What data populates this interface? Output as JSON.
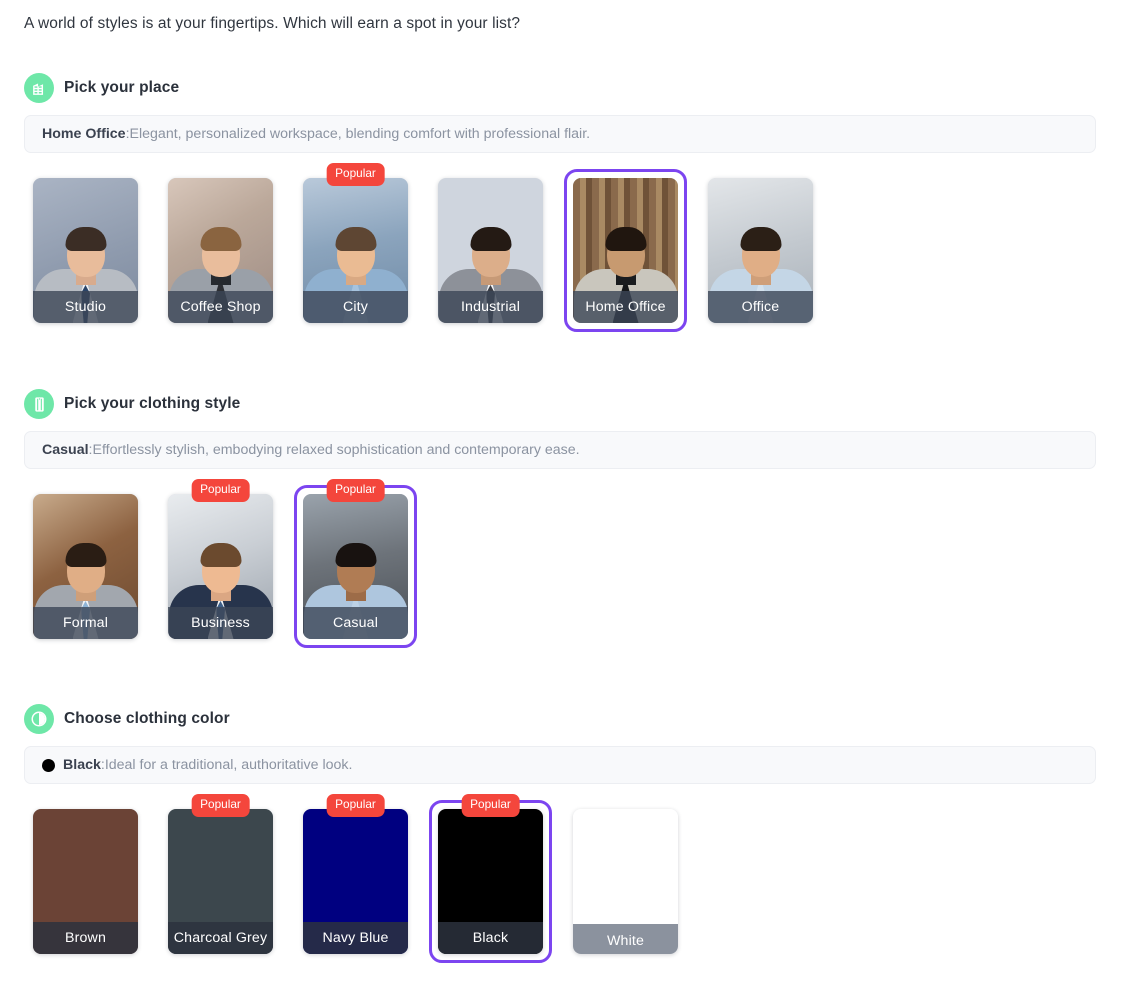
{
  "intro": "A world of styles is at your fingertips. Which will earn a spot in your list?",
  "colors": {
    "accent_purple": "#7c45f0",
    "badge_red": "#f4463c",
    "icon_green": "#6ee7a8",
    "label_bar": "#3c4656"
  },
  "sections": [
    {
      "id": "place",
      "icon": "building-icon",
      "title": "Pick your place",
      "description": {
        "name": "Home Office",
        "separator": ":",
        "text": " Elegant, personalized workspace, blending comfort with professional flair."
      },
      "cards": [
        {
          "label": "Studio",
          "popular": false,
          "selected": false
        },
        {
          "label": "Coffee Shop",
          "popular": false,
          "selected": false
        },
        {
          "label": "City",
          "popular": true,
          "selected": false
        },
        {
          "label": "Industrial",
          "popular": false,
          "selected": false
        },
        {
          "label": "Home Office",
          "popular": false,
          "selected": true
        },
        {
          "label": "Office",
          "popular": false,
          "selected": false
        }
      ]
    },
    {
      "id": "style",
      "icon": "shirt-icon",
      "title": "Pick your clothing style",
      "description": {
        "name": "Casual",
        "separator": ":",
        "text": " Effortlessly stylish, embodying relaxed sophistication and contemporary ease."
      },
      "cards": [
        {
          "label": "Formal",
          "popular": false,
          "selected": false
        },
        {
          "label": "Business",
          "popular": true,
          "selected": false
        },
        {
          "label": "Casual",
          "popular": true,
          "selected": true
        }
      ]
    },
    {
      "id": "color",
      "icon": "contrast-icon",
      "title": "Choose clothing color",
      "description": {
        "swatch": "#000000",
        "name": "Black",
        "separator": ":",
        "text": " Ideal for a traditional, authoritative look."
      },
      "cards": [
        {
          "label": "Brown",
          "swatch": "#6b4336",
          "popular": false,
          "selected": false
        },
        {
          "label": "Charcoal Grey",
          "swatch": "#3c474d",
          "popular": true,
          "selected": false
        },
        {
          "label": "Navy Blue",
          "swatch": "#000080",
          "popular": true,
          "selected": false
        },
        {
          "label": "Black",
          "swatch": "#000000",
          "popular": true,
          "selected": true
        },
        {
          "label": "White",
          "swatch": "#ffffff",
          "popular": false,
          "selected": false
        }
      ]
    }
  ]
}
